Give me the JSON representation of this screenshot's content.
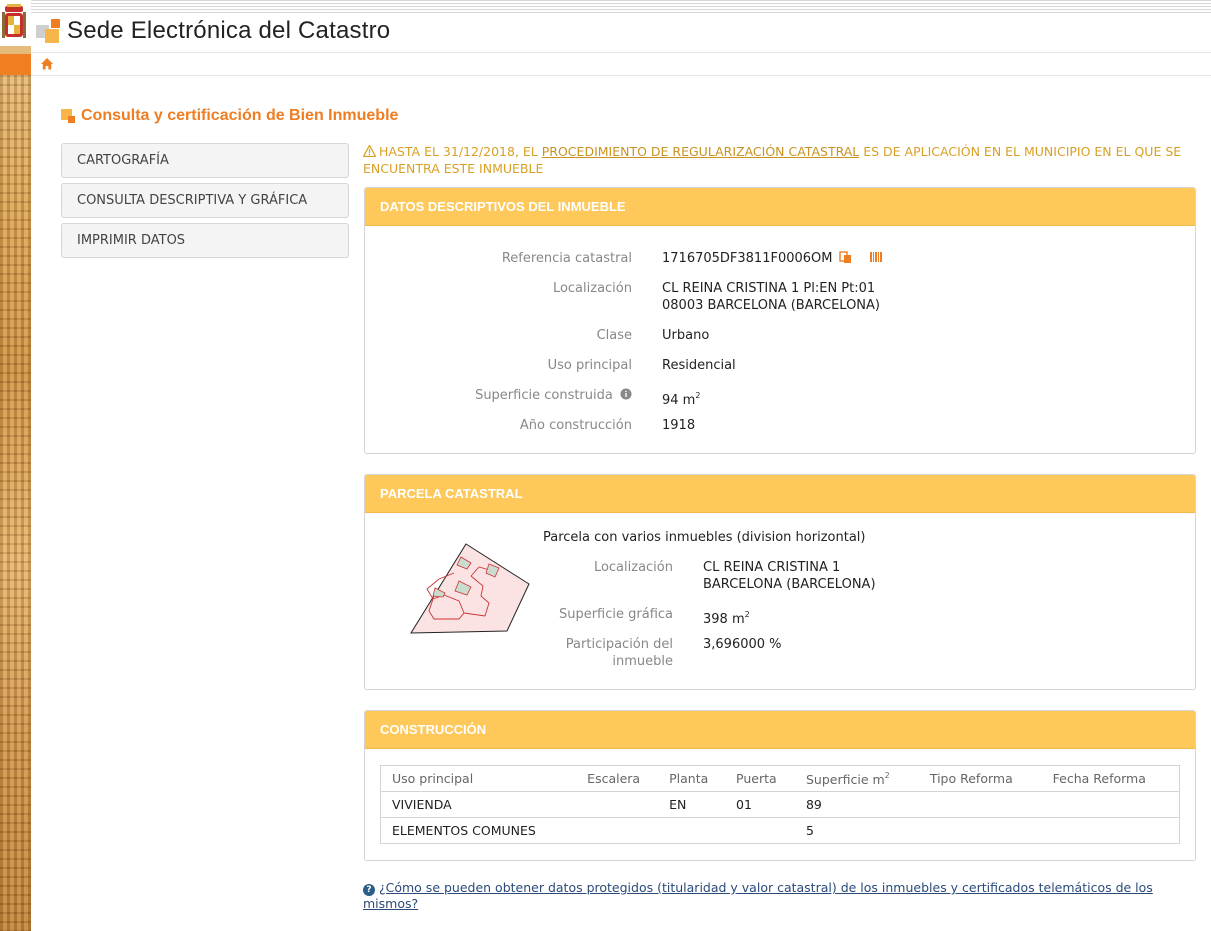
{
  "app": {
    "title": "Sede Electrónica del Catastro"
  },
  "page": {
    "heading": "Consulta y certificación de Bien Inmueble"
  },
  "menu": {
    "items": [
      {
        "label": "CARTOGRAFÍA"
      },
      {
        "label": "CONSULTA DESCRIPTIVA Y GRÁFICA"
      },
      {
        "label": "IMPRIMIR DATOS"
      }
    ]
  },
  "warning": {
    "prefix": "HASTA EL 31/12/2018, EL ",
    "link": "PROCEDIMIENTO DE REGULARIZACIÓN CATASTRAL",
    "suffix": " ES DE APLICACIÓN EN EL MUNICIPIO EN EL QUE SE ENCUENTRA ESTE INMUEBLE"
  },
  "datos": {
    "title": "DATOS DESCRIPTIVOS DEL INMUEBLE",
    "ref_label": "Referencia catastral",
    "ref_value": "1716705DF3811F0006OM",
    "loc_label": "Localización",
    "loc_line1": "CL REINA CRISTINA 1 Pl:EN Pt:01",
    "loc_line2": "08003 BARCELONA (BARCELONA)",
    "clase_label": "Clase",
    "clase_value": "Urbano",
    "uso_label": "Uso principal",
    "uso_value": "Residencial",
    "sup_label": "Superficie construida",
    "sup_value": "94 m",
    "sup_exp": "2",
    "anio_label": "Año construcción",
    "anio_value": "1918"
  },
  "parcela": {
    "title": "PARCELA CATASTRAL",
    "desc": "Parcela con varios inmuebles (division horizontal)",
    "loc_label": "Localización",
    "loc_line1": "CL REINA CRISTINA 1",
    "loc_line2": "BARCELONA (BARCELONA)",
    "sup_label": "Superficie gráfica",
    "sup_value": "398 m",
    "sup_exp": "2",
    "part_label_1": "Participación del",
    "part_label_2": "inmueble",
    "part_value": "3,696000 %"
  },
  "construccion": {
    "title": "CONSTRUCCIÓN",
    "headers": [
      "Uso principal",
      "Escalera",
      "Planta",
      "Puerta",
      "Superficie m",
      "Tipo Reforma",
      "Fecha Reforma"
    ],
    "sup_header_exp": "2",
    "rows": [
      [
        "VIVIENDA",
        "",
        "EN",
        "01",
        "89",
        "",
        ""
      ],
      [
        "ELEMENTOS COMUNES",
        "",
        "",
        "",
        "5",
        "",
        ""
      ]
    ]
  },
  "help": {
    "link": "¿Cómo se pueden obtener datos protegidos (titularidad y valor catastral) de los inmuebles y certificados telemáticos de los mismos?"
  },
  "colors": {
    "accent": "#ef7d22",
    "panel_head": "#fec85a",
    "warning": "#d9a026"
  },
  "icons": [
    "home-icon",
    "copy-icon",
    "barcode-icon",
    "info-icon",
    "warning-icon",
    "help-icon",
    "catastro-logo"
  ]
}
